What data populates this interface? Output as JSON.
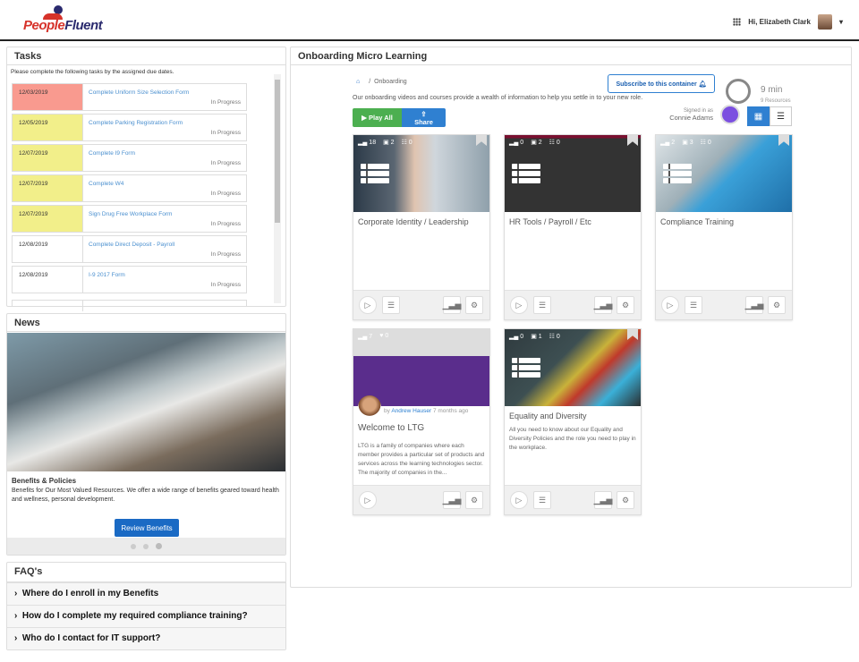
{
  "header": {
    "logo": "PeopleFluent",
    "greeting": "Hi, Elizabeth Clark"
  },
  "tasks": {
    "title": "Tasks",
    "intro": "Please complete the following tasks by the assigned due dates.",
    "items": [
      {
        "date": "12/03/2019",
        "name": "Complete Uniform Size Selection Form",
        "status": "In Progress",
        "color": "#f99a8f"
      },
      {
        "date": "12/05/2019",
        "name": "Complete Parking Registration Form",
        "status": "In Progress",
        "color": "#f2ef8a"
      },
      {
        "date": "12/07/2019",
        "name": "Complete I9 Form",
        "status": "In Progress",
        "color": "#f2ef8a"
      },
      {
        "date": "12/07/2019",
        "name": "Complete W4",
        "status": "In Progress",
        "color": "#f2ef8a"
      },
      {
        "date": "12/07/2019",
        "name": "Sign Drug Free Workplace Form",
        "status": "In Progress",
        "color": "#f2ef8a"
      },
      {
        "date": "12/08/2019",
        "name": "Complete Direct Deposit - Payroll",
        "status": "In Progress",
        "color": "#ffffff"
      },
      {
        "date": "12/08/2019",
        "name": "I-9 2017 Form",
        "status": "In Progress",
        "color": "#ffffff"
      }
    ]
  },
  "news": {
    "title": "News",
    "item_title": "Benefits & Policies",
    "item_text": "Benefits for Our Most Valued Resources. We offer a wide range of benefits geared toward health and wellness, personal development.",
    "button": "Review Benefits",
    "slide": 3,
    "slides": 3
  },
  "faq": {
    "title": "FAQ's",
    "items": [
      "Where do I enroll in my Benefits",
      "How do I complete my required compliance training?",
      "Who do I contact for IT support?"
    ]
  },
  "main": {
    "title": "Onboarding Micro Learning",
    "breadcrumb": "Onboarding",
    "description": "Our onboarding videos and courses provide a wealth of information to help you settle in to your new role.",
    "play_all": "Play All",
    "share": "Share",
    "subscribe": "Subscribe to this container",
    "duration": "9 min",
    "resources": "9 Resources",
    "signed_in_label": "Signed in as",
    "signed_in_user": "Connie Adams",
    "cards": [
      {
        "title": "Corporate Identity / Leadership",
        "s1": "18",
        "s2": "2",
        "s3": "0"
      },
      {
        "title": "HR Tools / Payroll / Etc",
        "s1": "0",
        "s2": "2",
        "s3": "0"
      },
      {
        "title": "Compliance Training",
        "s1": "2",
        "s2": "3",
        "s3": "0"
      },
      {
        "title": "Welcome to LTG",
        "s1": "7",
        "s2": "0",
        "by": "by",
        "author": "Andrew Hauser",
        "ago": "7 months ago",
        "desc": "LTG is a family of companies where each member provides a particular set of products and services across the learning technologies sector. The majority of companies in the..."
      },
      {
        "title": "Equality and Diversity",
        "s1": "0",
        "s2": "1",
        "s3": "0",
        "desc": "All you need to know about our Equality and Diversity Policies and the role you need to play in the workplace."
      }
    ]
  }
}
